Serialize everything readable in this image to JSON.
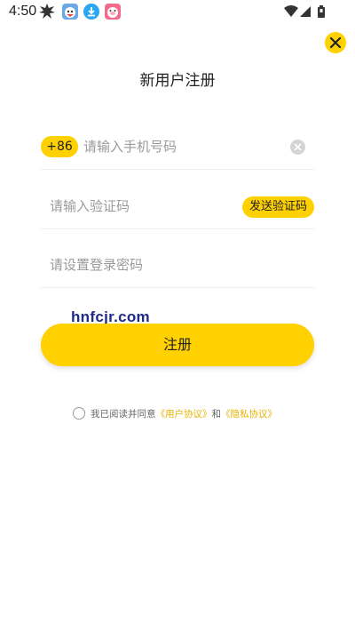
{
  "status_bar": {
    "time": "4:50",
    "icons": [
      "explosion-app-icon",
      "shark-app-icon",
      "download-icon",
      "pig-app-icon",
      "wifi-icon",
      "signal-icon",
      "battery-icon"
    ]
  },
  "header": {
    "title": "新用户注册",
    "close_icon": "close-icon"
  },
  "form": {
    "country_code": "+86",
    "phone_placeholder": "请输入手机号码",
    "code_placeholder": "请输入验证码",
    "send_code_label": "发送验证码",
    "password_placeholder": "请设置登录密码"
  },
  "watermark": "hnfcjr.com",
  "register_label": "注册",
  "agreement": {
    "prefix": "我已阅读并同意",
    "user_agreement": "《用户协议》",
    "and": "和",
    "privacy_policy": "《隐私协议》"
  },
  "colors": {
    "accent": "#FFD100",
    "link": "#E8B400",
    "placeholder": "#9a9a9a",
    "divider": "#eeeeee"
  }
}
